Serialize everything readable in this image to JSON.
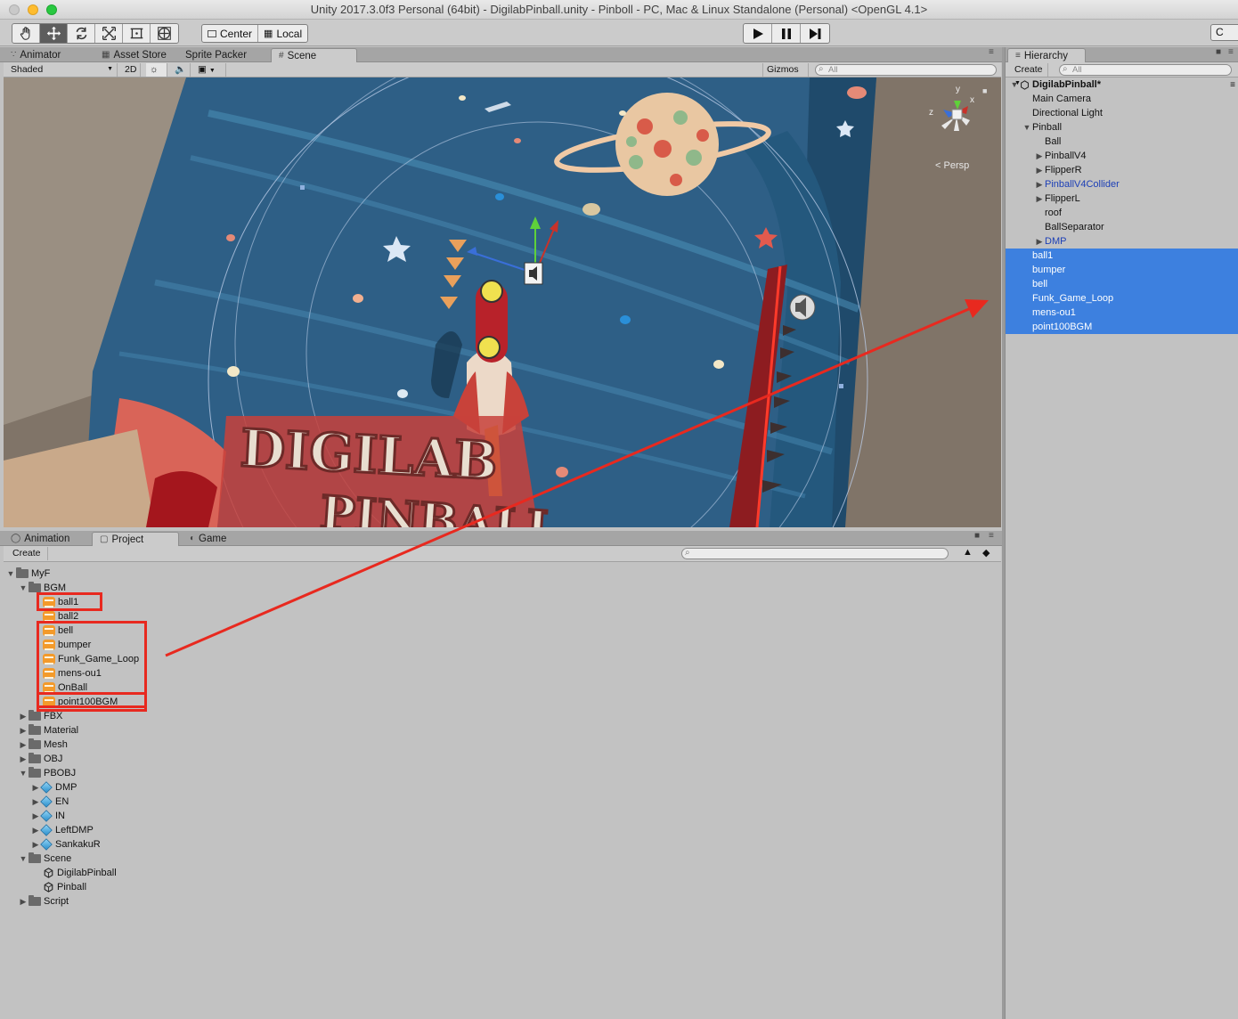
{
  "window": {
    "title": "Unity 2017.3.0f3 Personal (64bit) - DigilabPinball.unity - Pinboll - PC, Mac & Linux Standalone (Personal) <OpenGL 4.1>"
  },
  "toolbar": {
    "pivot_label": "Center",
    "space_label": "Local",
    "collab_label": "C"
  },
  "top_tabs": [
    {
      "label": "Animator",
      "icon": "animator-icon"
    },
    {
      "label": "Asset Store",
      "icon": "store-icon"
    },
    {
      "label": "Sprite Packer",
      "icon": ""
    },
    {
      "label": "Scene",
      "icon": "grid-icon"
    }
  ],
  "scene_toolbar": {
    "shading": "Shaded",
    "mode_2d": "2D",
    "gizmos": "Gizmos",
    "search_placeholder": "All"
  },
  "scene_view": {
    "persp_label": "Persp",
    "axis_x": "x",
    "axis_y": "y",
    "axis_z": "z",
    "playfield_text_1": "DIGILAB",
    "playfield_text_2": "PINBALL"
  },
  "bottom_tabs": [
    {
      "label": "Animation",
      "icon": "animation-icon"
    },
    {
      "label": "Project",
      "icon": "folder-icon"
    },
    {
      "label": "Game",
      "icon": "game-icon"
    }
  ],
  "project": {
    "create_label": "Create",
    "search_placeholder": "",
    "tree": [
      {
        "label": "MyF",
        "type": "folder",
        "expanded": true
      },
      {
        "label": "BGM",
        "type": "folder",
        "expanded": true
      },
      {
        "label": "ball1",
        "type": "audio"
      },
      {
        "label": "ball2",
        "type": "audio"
      },
      {
        "label": "bell",
        "type": "audio"
      },
      {
        "label": "bumper",
        "type": "audio"
      },
      {
        "label": "Funk_Game_Loop",
        "type": "audio"
      },
      {
        "label": "mens-ou1",
        "type": "audio"
      },
      {
        "label": "OnBall",
        "type": "audio"
      },
      {
        "label": "point100BGM",
        "type": "audio"
      },
      {
        "label": "FBX",
        "type": "folder",
        "expanded": false
      },
      {
        "label": "Material",
        "type": "folder",
        "expanded": false
      },
      {
        "label": "Mesh",
        "type": "folder",
        "expanded": false
      },
      {
        "label": "OBJ",
        "type": "folder",
        "expanded": false
      },
      {
        "label": "PBOBJ",
        "type": "folder",
        "expanded": true
      },
      {
        "label": "DMP",
        "type": "prefab"
      },
      {
        "label": "EN",
        "type": "prefab"
      },
      {
        "label": "IN",
        "type": "prefab"
      },
      {
        "label": "LeftDMP",
        "type": "prefab"
      },
      {
        "label": "SankakuR",
        "type": "prefab"
      },
      {
        "label": "Scene",
        "type": "folder",
        "expanded": true
      },
      {
        "label": "DigilabPinball",
        "type": "scene"
      },
      {
        "label": "Pinball",
        "type": "scene"
      },
      {
        "label": "Script",
        "type": "folder",
        "expanded": false
      }
    ]
  },
  "hierarchy": {
    "tab_label": "Hierarchy",
    "create_label": "Create",
    "search_placeholder": "All",
    "items": [
      {
        "label": "DigilabPinball*",
        "kind": "scene"
      },
      {
        "label": "Main Camera",
        "kind": "object"
      },
      {
        "label": "Directional Light",
        "kind": "object"
      },
      {
        "label": "Pinball",
        "kind": "object"
      },
      {
        "label": "Ball",
        "kind": "object"
      },
      {
        "label": "PinballV4",
        "kind": "object"
      },
      {
        "label": "FlipperR",
        "kind": "object"
      },
      {
        "label": "PinballV4Collider",
        "kind": "prefab"
      },
      {
        "label": "FlipperL",
        "kind": "object"
      },
      {
        "label": "roof",
        "kind": "object"
      },
      {
        "label": "BallSeparator",
        "kind": "object"
      },
      {
        "label": "DMP",
        "kind": "prefab"
      },
      {
        "label": "ball1",
        "kind": "selected"
      },
      {
        "label": "bumper",
        "kind": "selected"
      },
      {
        "label": "bell",
        "kind": "selected"
      },
      {
        "label": "Funk_Game_Loop",
        "kind": "selected"
      },
      {
        "label": "mens-ou1",
        "kind": "selected"
      },
      {
        "label": "point100BGM",
        "kind": "selected"
      }
    ]
  },
  "colors": {
    "selection": "#3d80df",
    "annotation_red": "#e8291f",
    "audio_icon": "#f39a2b",
    "prefab_link": "#1c3fb6"
  }
}
